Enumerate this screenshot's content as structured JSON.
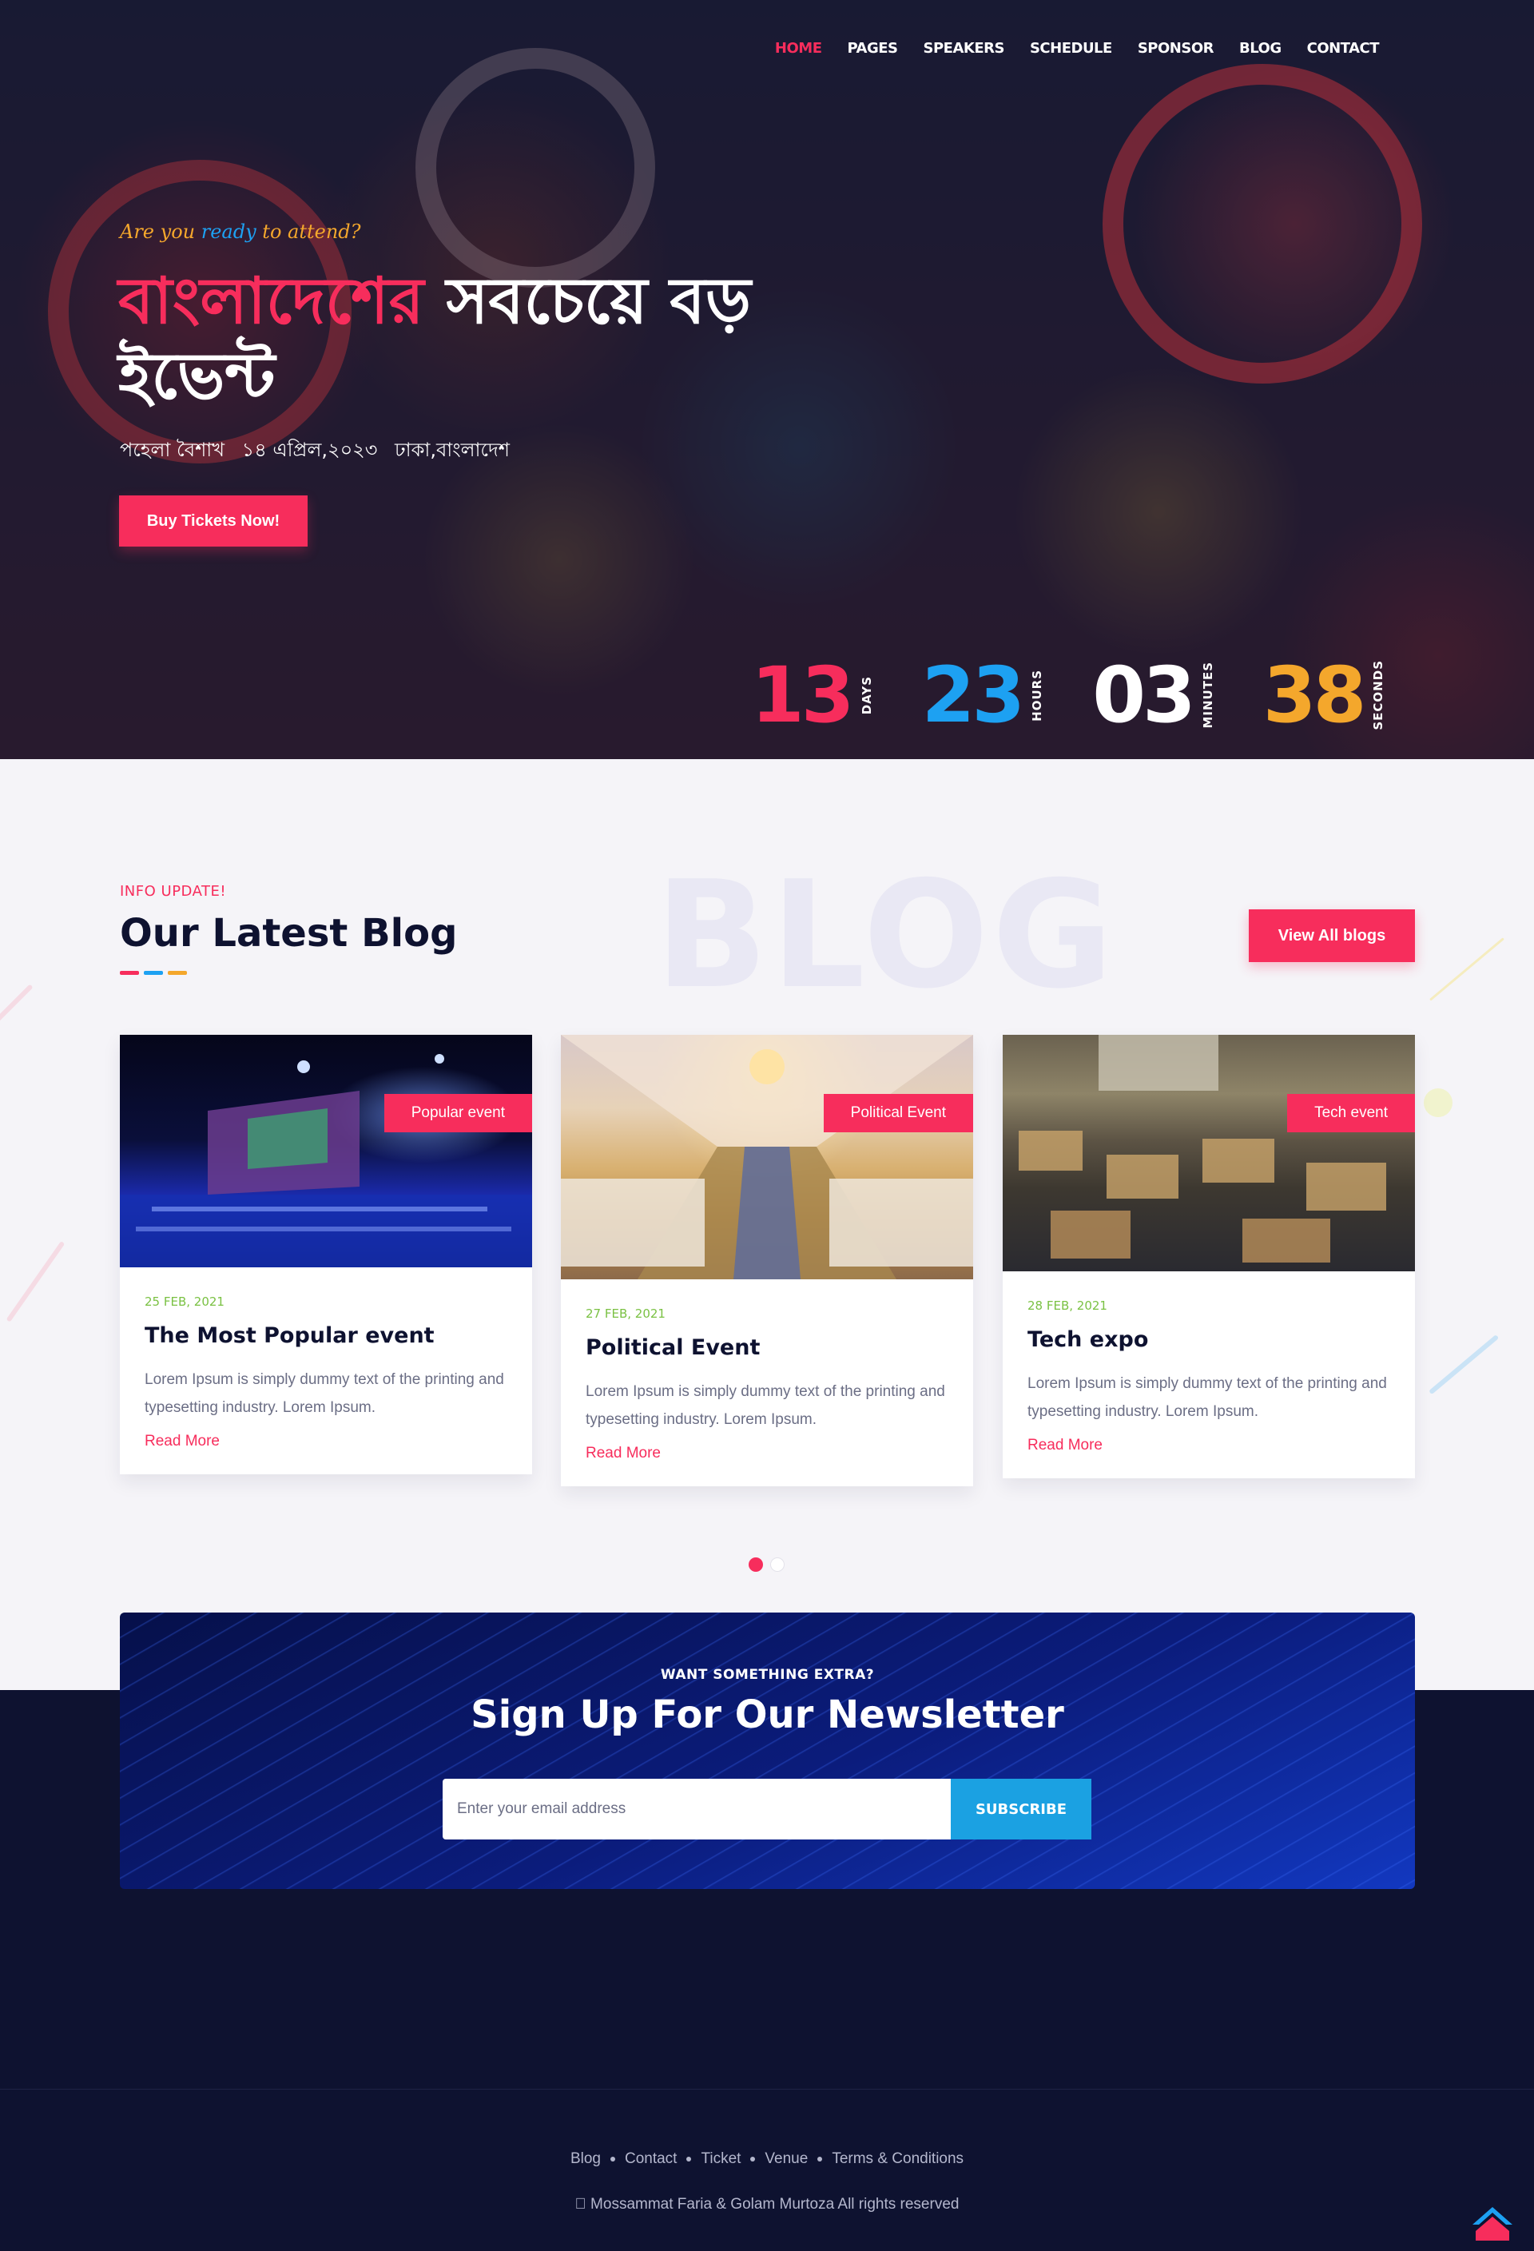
{
  "nav": {
    "items": [
      "HOME",
      "PAGES",
      "SPEAKERS",
      "SCHEDULE",
      "SPONSOR",
      "BLOG",
      "CONTACT"
    ],
    "active_color": "#f72d5c"
  },
  "hero": {
    "tagline_pre": "Are you",
    "tagline_highlight": "ready",
    "tagline_post": "to attend?",
    "title_highlight": "বাংলাদেশের",
    "title_rest": " সবচেয়ে বড় ইভেন্ট",
    "meta_event": "পহেলা বৈশাখ",
    "meta_date": "১৪ এপ্রিল,২০২৩",
    "meta_place": "ঢাকা,বাংলাদেশ",
    "cta_label": "Buy Tickets Now!"
  },
  "countdown": [
    {
      "value": "13",
      "label": "DAYS",
      "color": "#f72d5c"
    },
    {
      "value": "23",
      "label": "HOURS",
      "color": "#1da1f2"
    },
    {
      "value": "03",
      "label": "MINUTES",
      "color": "#ffffff"
    },
    {
      "value": "38",
      "label": "SECONDS",
      "color": "#f4a72c"
    }
  ],
  "blog": {
    "bg_word": "BLOG",
    "kicker": "INFO UPDATE!",
    "title": "Our Latest Blog",
    "view_all_label": "View All blogs",
    "underline_colors": [
      "#f72d5c",
      "#1da1f2",
      "#f4a72c"
    ],
    "posts": [
      {
        "category": "Popular event",
        "date": "25 FEB, 2021",
        "title": "The Most Popular event",
        "excerpt": "Lorem Ipsum is simply dummy text of the printing and typesetting industry. Lorem Ipsum.",
        "link": "Read More"
      },
      {
        "category": "Political Event",
        "date": "27 FEB, 2021",
        "title": "Political Event",
        "excerpt": "Lorem Ipsum is simply dummy text of the printing and typesetting industry. Lorem Ipsum.",
        "link": "Read More"
      },
      {
        "category": "Tech event",
        "date": "28 FEB, 2021",
        "title": "Tech expo",
        "excerpt": "Lorem Ipsum is simply dummy text of the printing and typesetting industry. Lorem Ipsum.",
        "link": "Read More"
      }
    ],
    "carousel": {
      "active_index": 0,
      "count": 2
    }
  },
  "newsletter": {
    "kicker": "WANT SOMETHING EXTRA?",
    "title": "Sign Up For Our Newsletter",
    "placeholder": "Enter your email address",
    "button": "SUBSCRIBE"
  },
  "footer": {
    "links": [
      "Blog",
      "Contact",
      "Ticket",
      "Venue",
      "Terms & Conditions"
    ],
    "copyright": "\u0000 Mossammat Faria & Golam Murtoza All rights reserved",
    "to_top_icon": "arrow-up-icon"
  },
  "colors": {
    "accent": "#f72d5c",
    "blue": "#1da1f2",
    "gold": "#f4a72c",
    "navy": "#0e1230"
  }
}
